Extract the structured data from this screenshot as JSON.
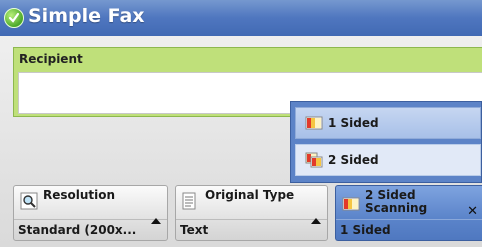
{
  "window": {
    "title": "Simple Fax",
    "icon": "check-circle-icon"
  },
  "recipient": {
    "label": "Recipient",
    "value": ""
  },
  "dropdown": {
    "options": [
      {
        "label": "1 Sided",
        "icon": "one-sided-page-icon"
      },
      {
        "label": "2 Sided",
        "icon": "two-sided-page-icon"
      }
    ]
  },
  "buttons": {
    "resolution": {
      "title": "Resolution",
      "value": "Standard (200x...",
      "icon": "magnifier-icon"
    },
    "original_type": {
      "title": "Original Type",
      "value": "Text",
      "icon": "document-icon"
    },
    "two_sided": {
      "title_line1": "2 Sided",
      "title_line2": "Scanning",
      "value": "1 Sided",
      "icon": "one-sided-page-icon"
    }
  },
  "colors": {
    "title_bar": "#4f76bf",
    "recipient_band": "#bfe07a",
    "selected_blue": "#5b84ca"
  }
}
